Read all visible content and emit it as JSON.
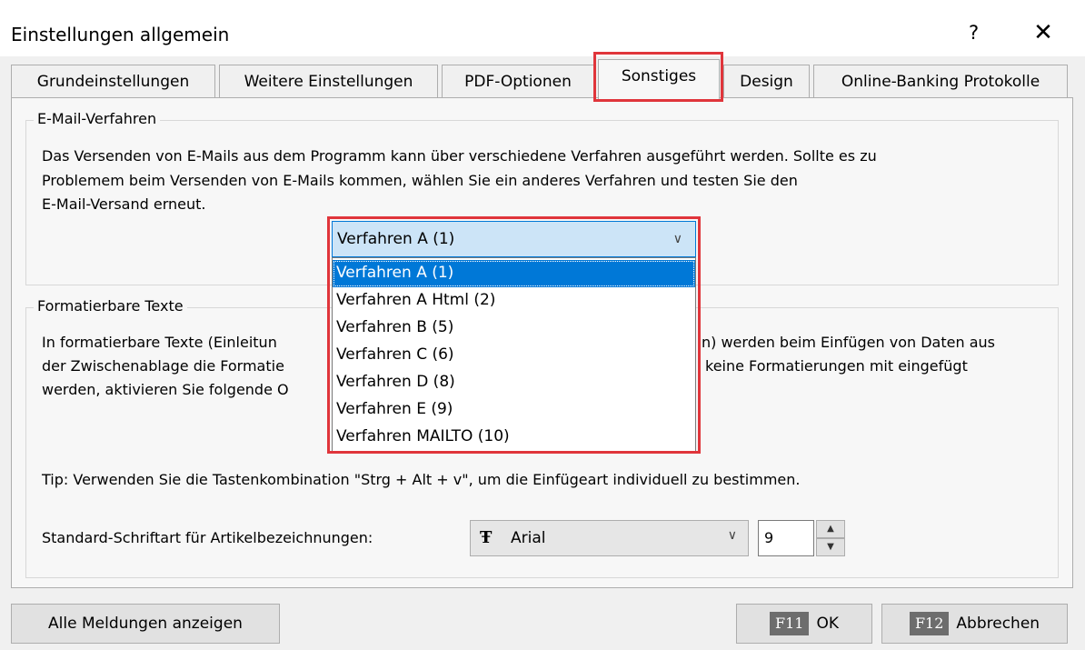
{
  "window": {
    "title": "Einstellungen allgemein",
    "help_label": "?",
    "close_label": "✕"
  },
  "tabs": [
    {
      "label": "Grundeinstellungen"
    },
    {
      "label": "Weitere Einstellungen"
    },
    {
      "label": "PDF-Optionen"
    },
    {
      "label": "Sonstiges",
      "active": true
    },
    {
      "label": "Design"
    },
    {
      "label": "Online-Banking Protokolle"
    }
  ],
  "email_group": {
    "label": "E-Mail-Verfahren",
    "description_lines": [
      "Das Versenden von E-Mails aus dem Programm kann über verschiedene Verfahren ausgeführt werden. Sollte es zu",
      "Problemem beim Versenden von E-Mails kommen, wählen Sie ein anderes Verfahren und testen Sie den",
      "E-Mail-Versand erneut."
    ],
    "combo_value": "Verfahren A (1)",
    "options": [
      "Verfahren A (1)",
      "Verfahren A Html (2)",
      "Verfahren B (5)",
      "Verfahren C (6)",
      "Verfahren D (8)",
      "Verfahren E (9)",
      "Verfahren MAILTO (10)"
    ]
  },
  "text_group": {
    "label": "Formatierbare Texte",
    "lines_left": [
      "In formatierbare Texte (Einleitun",
      "der Zwischenablage die Formatie",
      "werden, aktivieren Sie folgende O"
    ],
    "lines_right": [
      "n) werden beim Einfügen von Daten aus",
      "keine Formatierungen mit eingefügt"
    ],
    "tip": "Tip: Verwenden Sie die Tastenkombination \"Strg + Alt + v\", um die Einfügeart individuell zu bestimmen.",
    "font_label": "Standard-Schriftart für Artikelbezeichnungen:",
    "font_icon": "Ŧ",
    "font_value": "Arial",
    "font_size": "9"
  },
  "footer": {
    "show_all_label": "Alle Meldungen anzeigen",
    "ok_key": "F11",
    "ok_label": "OK",
    "cancel_key": "F12",
    "cancel_label": "Abbrechen"
  },
  "icons": {
    "combo_chevron": "chevron-down-icon",
    "font_type": "truetype-font-icon",
    "spin_up": "spin-up-icon",
    "spin_down": "spin-down-icon"
  },
  "colors": {
    "highlight": "#e0353b",
    "selection": "#0078d7",
    "combo_bg": "#cce4f7"
  }
}
